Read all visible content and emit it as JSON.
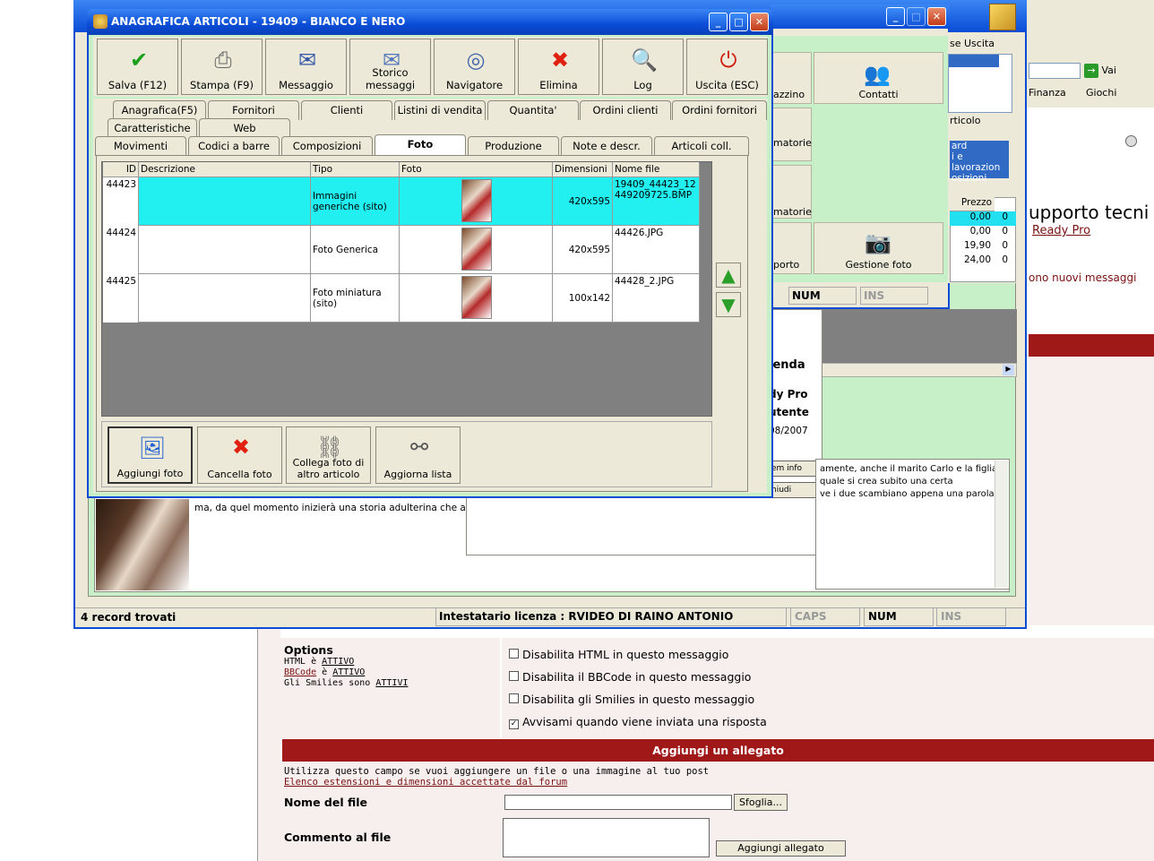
{
  "main_window": {
    "title": "ANAGRAFICA ARTICOLI - 19409 - BIANCO E NERO"
  },
  "toolbar": [
    {
      "label": "Salva (F12)",
      "icon": "check-icon",
      "color": "#1aa01a",
      "glyph": "✔"
    },
    {
      "label": "Stampa (F9)",
      "icon": "printer-icon",
      "color": "#666",
      "glyph": "⎙"
    },
    {
      "label": "Messaggio",
      "icon": "message-icon",
      "color": "#3355aa",
      "glyph": "✉"
    },
    {
      "label": "Storico messaggi",
      "icon": "message-history-icon",
      "color": "#5577bb",
      "glyph": "✉"
    },
    {
      "label": "Navigatore",
      "icon": "compass-icon",
      "color": "#4466aa",
      "glyph": "◎"
    },
    {
      "label": "Elimina",
      "icon": "delete-icon",
      "color": "#e02010",
      "glyph": "✖"
    },
    {
      "label": "Log",
      "icon": "log-icon",
      "color": "#2a5ab0",
      "glyph": "🔍"
    },
    {
      "label": "Uscita (ESC)",
      "icon": "exit-icon",
      "color": "#d02010",
      "glyph": "⏻"
    }
  ],
  "tabs_row1": [
    "Anagrafica(F5)",
    "Fornitori",
    "Clienti",
    "Listini di vendita",
    "Quantita'",
    "Ordini clienti",
    "Ordini fornitori"
  ],
  "tabs_row2": [
    "Caratteristiche",
    "Web"
  ],
  "tabs_row3": [
    "Movimenti",
    "Codici a barre",
    "Composizioni",
    "Foto",
    "Produzione",
    "Note e descr.",
    "Articoli coll."
  ],
  "grid": {
    "headers": [
      "ID",
      "Descrizione",
      "Tipo",
      "Foto",
      "Dimensioni",
      "Nome file"
    ],
    "rows": [
      {
        "id": "44423",
        "descrizione": "",
        "tipo": "Immagini generiche (sito)",
        "dim": "420x595",
        "file": "19409_44423_12449209725.BMP"
      },
      {
        "id": "44424",
        "descrizione": "",
        "tipo": "Foto Generica",
        "dim": "420x595",
        "file": "44426.JPG"
      },
      {
        "id": "44425",
        "descrizione": "",
        "tipo": "Foto miniatura (sito)",
        "dim": "100x142",
        "file": "44428_2.JPG"
      }
    ]
  },
  "bottom_buttons": [
    {
      "label": "Aggiungi foto",
      "icon": "add-photo-icon",
      "glyph": "🖼"
    },
    {
      "label": "Cancella foto",
      "icon": "delete-icon",
      "glyph": "✖"
    },
    {
      "label": "Collega foto di altro articolo",
      "icon": "link-icon",
      "glyph": "⛓"
    },
    {
      "label": "Aggiorna lista",
      "icon": "binoculars-icon",
      "glyph": "⚯"
    }
  ],
  "back_window": {
    "right_buttons": [
      "Contatti",
      "Gestione foto"
    ],
    "left_partial": [
      "azzino",
      "matorie",
      "matorie",
      "porto"
    ],
    "status": [
      "NUM",
      "INS"
    ],
    "close_label": "se Uscita",
    "articolo": "rticolo",
    "list_items": [
      "ard",
      "i e lavorazion",
      "osizioni"
    ],
    "price_header": "Prezzo",
    "prices": [
      "0,00",
      "0,00",
      "19,90",
      "24,00"
    ],
    "qty": [
      "0",
      "0",
      "0",
      "0"
    ]
  },
  "mid_window": {
    "texts": [
      "ienda",
      "dy Pro",
      "utente",
      "08/2007"
    ],
    "btn1": "em info",
    "btn2": "hiudi"
  },
  "description_text": "ma, da quel momento inizierà una storia adulterina che andrà pc",
  "notes_lines": [
    "amente, anche il marito Carlo e la figlia",
    "quale si crea subito una certa",
    "ve i due scambiano appena una parola,"
  ],
  "status_bar": {
    "records": "4 record trovati",
    "license": "Intestatario licenza : RVIDEO DI RAINO ANTONIO",
    "caps": "CAPS",
    "num": "NUM",
    "ins": "INS"
  },
  "browser": {
    "vai": "Vai",
    "finanza": "Finanza",
    "giochi": "Giochi",
    "heading": "upporto tecni",
    "link": "Ready Pro",
    "msg": "ono nuovi messaggi"
  },
  "forum": {
    "options_title": "Options",
    "opt_lines": [
      {
        "pre": "HTML è ",
        "link": "ATTIVO"
      },
      {
        "link": "BBCode",
        "mid": " è ",
        "link2": "ATTIVO"
      },
      {
        "pre": "Gli Smilies sono ",
        "link": "ATTIVI"
      }
    ],
    "checkboxes": [
      {
        "label": "Disabilita HTML in questo messaggio",
        "checked": false
      },
      {
        "label": "Disabilita il BBCode in questo messaggio",
        "checked": false
      },
      {
        "label": "Disabilita gli Smilies in questo messaggio",
        "checked": false
      },
      {
        "label": "Avvisami quando viene inviata una risposta",
        "checked": true
      }
    ],
    "attach_header": "Aggiungi un allegato",
    "attach_desc": "Utilizza questo campo se vuoi aggiungere un file o una immagine al tuo post",
    "attach_link": "Elenco estensioni e dimensioni accettate dal forum",
    "file_label": "Nome del file",
    "browse": "Sfoglia...",
    "comment_label": "Commento al file",
    "add_btn": "Aggiungi allegato"
  }
}
